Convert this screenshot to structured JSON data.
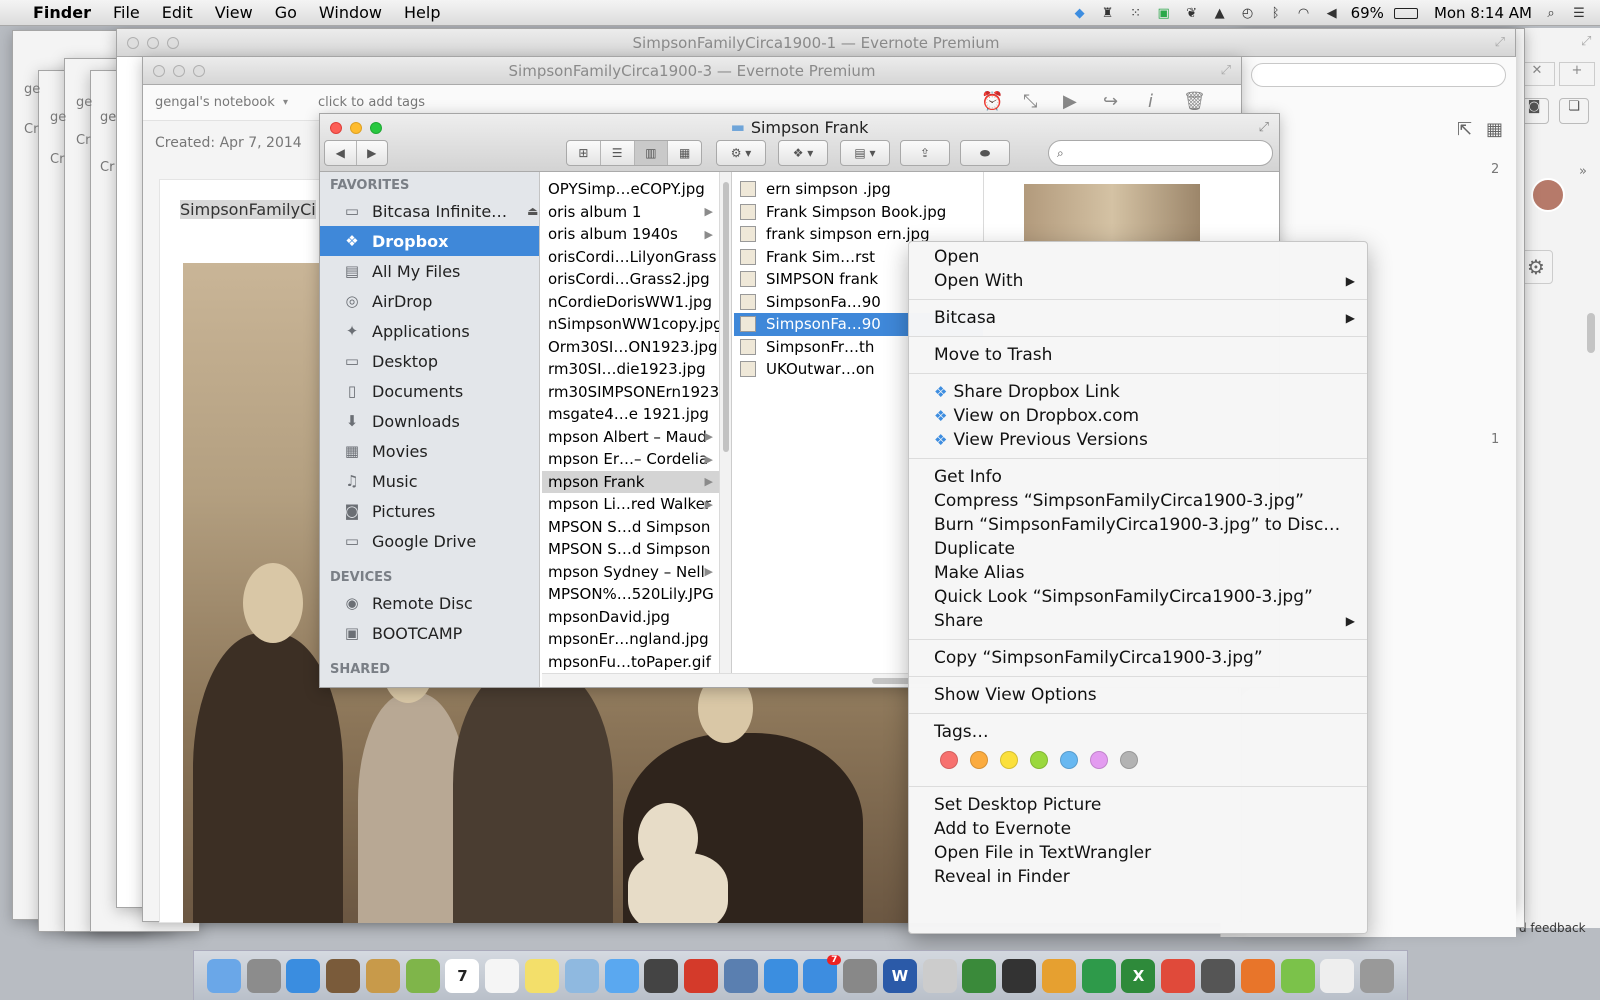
{
  "menubar": {
    "apple_icon": "apple-icon",
    "app_name": "Finder",
    "items": [
      "File",
      "Edit",
      "View",
      "Go",
      "Window",
      "Help"
    ],
    "battery": "69%",
    "clock": "Mon 8:14 AM"
  },
  "evernote": {
    "window1_title": "SimpsonFamilyCirca1900-1 — Evernote Premium",
    "window3_title": "SimpsonFamilyCirca1900-3 — Evernote Premium",
    "notebook": "gengal's notebook",
    "tags_placeholder": "click to add tags",
    "created": "Created: Apr 7, 2014",
    "note_title": "SimpsonFamilyCi",
    "ghost_labels": [
      "ge",
      "ge",
      "ge",
      "ge",
      "ge",
      "Cr",
      "Cr",
      "Cr",
      "Cr",
      "Cr"
    ],
    "right_count_1": "2",
    "right_count_2": "1",
    "feedback": "d feedback"
  },
  "finder": {
    "title": "Simpson Frank",
    "search_placeholder": "",
    "sidebar": {
      "favorites_header": "FAVORITES",
      "favorites": [
        {
          "label": "Bitcasa Infinite…",
          "icon": "folder-icon"
        },
        {
          "label": "Dropbox",
          "icon": "dropbox-icon"
        },
        {
          "label": "All My Files",
          "icon": "all-files-icon"
        },
        {
          "label": "AirDrop",
          "icon": "airdrop-icon"
        },
        {
          "label": "Applications",
          "icon": "applications-icon"
        },
        {
          "label": "Desktop",
          "icon": "desktop-icon"
        },
        {
          "label": "Documents",
          "icon": "documents-icon"
        },
        {
          "label": "Downloads",
          "icon": "downloads-icon"
        },
        {
          "label": "Movies",
          "icon": "movies-icon"
        },
        {
          "label": "Music",
          "icon": "music-icon"
        },
        {
          "label": "Pictures",
          "icon": "pictures-icon"
        },
        {
          "label": "Google Drive",
          "icon": "folder-icon"
        }
      ],
      "devices_header": "DEVICES",
      "devices": [
        {
          "label": "Remote Disc",
          "icon": "disc-icon"
        },
        {
          "label": "BOOTCAMP",
          "icon": "drive-icon"
        }
      ],
      "shared_header": "SHARED"
    },
    "column2": [
      {
        "name": "OPYSimp…eCOPY.jpg",
        "folder": false
      },
      {
        "name": "oris album 1",
        "folder": true
      },
      {
        "name": "oris album 1940s",
        "folder": true
      },
      {
        "name": "orisCordi…LilyonGrass",
        "folder": false
      },
      {
        "name": "orisCordi…Grass2.jpg",
        "folder": false
      },
      {
        "name": "nCordieDorisWW1.jpg",
        "folder": false
      },
      {
        "name": "nSimpsonWW1copy.jpg",
        "folder": false
      },
      {
        "name": "Orm30SI…ON1923.jpg",
        "folder": false
      },
      {
        "name": "rm30SI…die1923.jpg",
        "folder": false
      },
      {
        "name": "rm30SIMPSONErn1923",
        "folder": false
      },
      {
        "name": "msgate4…e 1921.jpg",
        "folder": false
      },
      {
        "name": "mpson Albert – Maud",
        "folder": true
      },
      {
        "name": "mpson Er…– Cordelia",
        "folder": true
      },
      {
        "name": "mpson Frank",
        "folder": true
      },
      {
        "name": "mpson Li…red Walker",
        "folder": true
      },
      {
        "name": "MPSON S…d Simpson",
        "folder": false
      },
      {
        "name": "MPSON S…d Simpson",
        "folder": false
      },
      {
        "name": "mpson Sydney – Nell",
        "folder": true
      },
      {
        "name": "MPSON%…520Lily.JPG",
        "folder": false
      },
      {
        "name": "mpsonDavid.jpg",
        "folder": false
      },
      {
        "name": "mpsonEr…ngland.jpg",
        "folder": false
      },
      {
        "name": "mpsonFu…toPaper.gif",
        "folder": false
      }
    ],
    "column3": [
      "ern simpson .jpg",
      "Frank Simpson Book.jpg",
      "frank simpson ern.jpg",
      "Frank Sim…rst",
      "SIMPSON frank",
      "SimpsonFa…90",
      "SimpsonFa…90",
      "SimpsonFr…th",
      "UKOutwar…on"
    ]
  },
  "context_menu": {
    "open": "Open",
    "open_with": "Open With",
    "bitcasa": "Bitcasa",
    "move_to_trash": "Move to Trash",
    "share_dropbox_link": "Share Dropbox Link",
    "view_on_dropbox": "View on Dropbox.com",
    "view_previous_versions": "View Previous Versions",
    "get_info": "Get Info",
    "compress": "Compress “SimpsonFamilyCirca1900-3.jpg”",
    "burn": "Burn “SimpsonFamilyCirca1900-3.jpg” to Disc…",
    "duplicate": "Duplicate",
    "make_alias": "Make Alias",
    "quick_look": "Quick Look “SimpsonFamilyCirca1900-3.jpg”",
    "share": "Share",
    "copy": "Copy “SimpsonFamilyCirca1900-3.jpg”",
    "show_view_options": "Show View Options",
    "tags": "Tags…",
    "tag_colors": [
      "#f7716f",
      "#fbab3f",
      "#fbe03c",
      "#9ad83e",
      "#68b8f1",
      "#e39cf0",
      "#b3b3b3"
    ],
    "set_desktop_picture": "Set Desktop Picture",
    "add_to_evernote": "Add to Evernote",
    "open_in_textwrangler": "Open File in TextWrangler",
    "reveal_in_finder": "Reveal in Finder"
  },
  "dock": {
    "items": [
      "finder-icon",
      "launchpad-icon",
      "safari-icon",
      "photo-booth-icon",
      "contacts-icon",
      "leaf-icon",
      "calendar-icon",
      "reminders-icon",
      "notes-icon",
      "preview-icon",
      "messages-icon",
      "facetime-icon",
      "photo-icon",
      "iphoto-icon",
      "itunes-icon",
      "app-store-icon",
      "system-prefs-icon",
      "word-icon",
      "scissors-icon",
      "evernote-icon",
      "grid-icon",
      "picasa-icon",
      "numbers-icon",
      "excel-icon",
      "chrome-icon",
      "sync-icon",
      "firefox-icon",
      "cloud-icon",
      "document-icon",
      "trash-icon"
    ],
    "calendar_day": "7",
    "app_store_badge": "7",
    "word_letter": "W",
    "excel_letter": "X"
  }
}
